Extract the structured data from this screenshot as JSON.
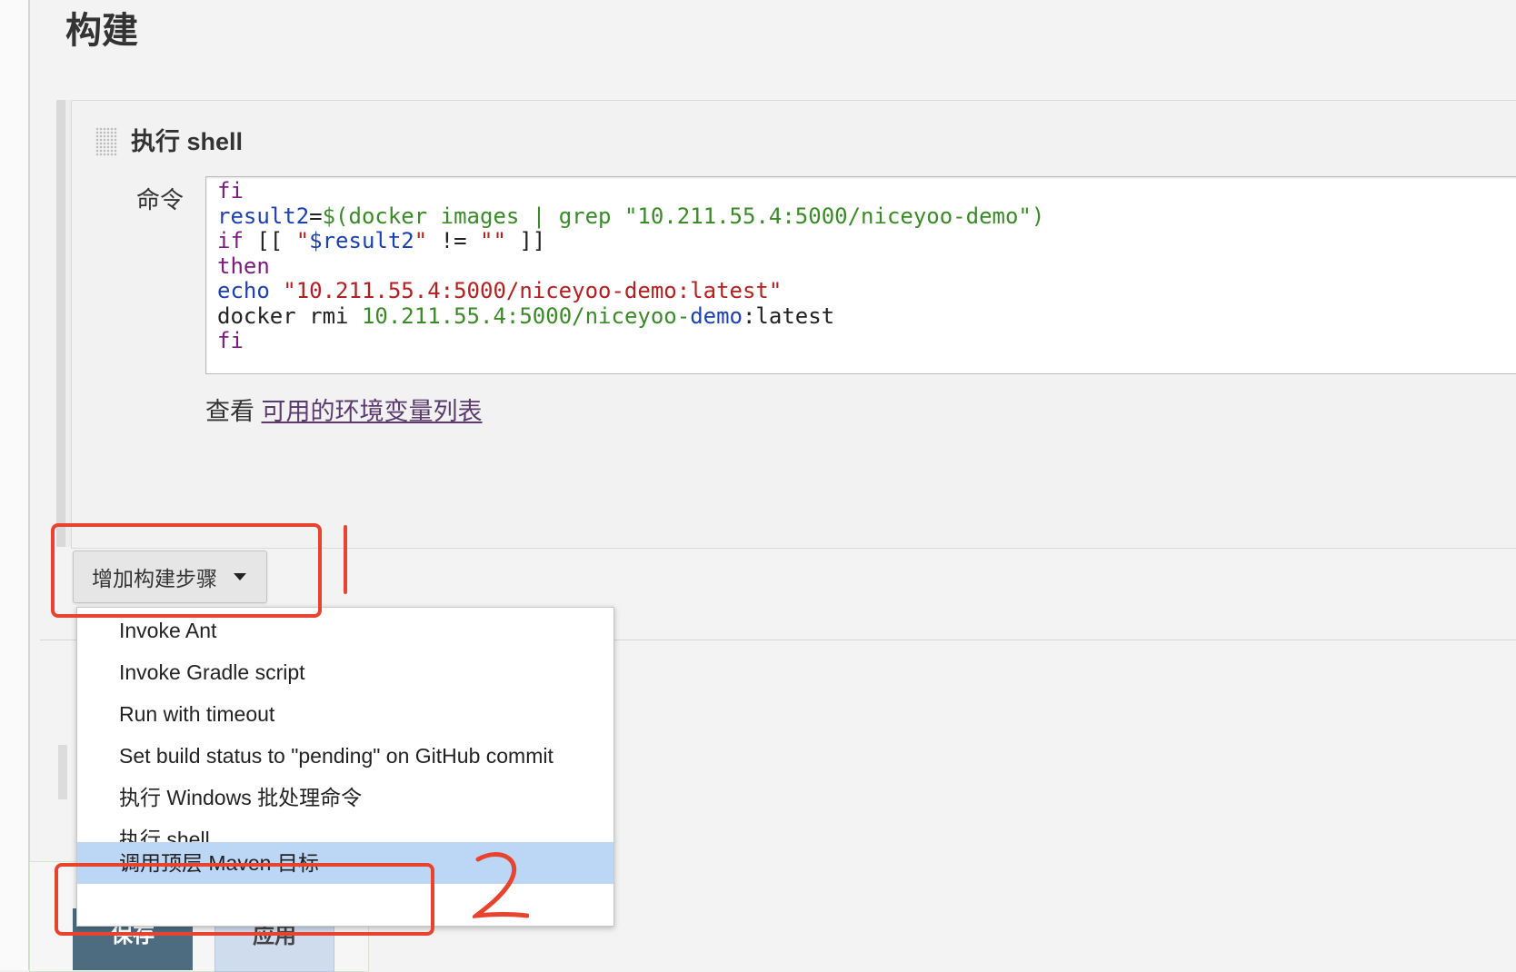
{
  "section": {
    "title": "构建"
  },
  "step": {
    "title": "执行 shell",
    "command_label": "命令",
    "code_lines": [
      "fi",
      "result2=$(docker images | grep \"10.211.55.4:5000/niceyoo-demo\")",
      "if [[ \"$result2\" != \"\" ]]",
      "then",
      "echo \"10.211.55.4:5000/niceyoo-demo:latest\"",
      "docker rmi 10.211.55.4:5000/niceyoo-demo:latest",
      "fi"
    ],
    "env_prefix": "查看",
    "env_link": "可用的环境变量列表"
  },
  "add_step_button": {
    "label": "增加构建步骤"
  },
  "menu": {
    "items": [
      {
        "label": "Invoke Ant"
      },
      {
        "label": "Invoke Gradle script"
      },
      {
        "label": "Run with timeout"
      },
      {
        "label": "Set build status to \"pending\" on GitHub commit"
      },
      {
        "label": "执行 Windows 批处理命令"
      },
      {
        "label": "执行 shell"
      },
      {
        "label": "调用顶层 Maven 目标",
        "selected": true
      }
    ]
  },
  "footer": {
    "save_label": "保存",
    "apply_label": "应用"
  },
  "annotations": {
    "mark1": "1",
    "mark2": "2"
  },
  "colors": {
    "annotation": "#e8432f",
    "menu_highlight": "#bcd6f6",
    "save_button": "#4d6c80"
  }
}
